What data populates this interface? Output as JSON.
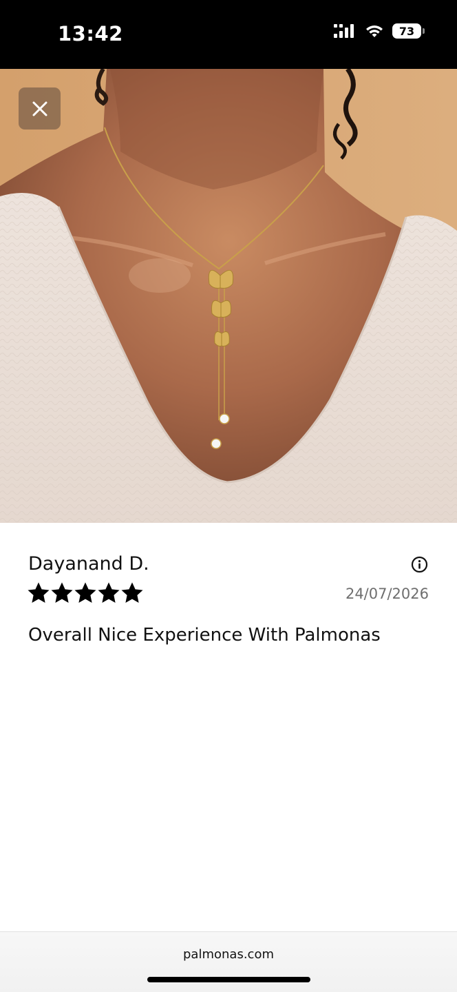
{
  "status_bar": {
    "time": "13:42",
    "battery_level": "73",
    "icons": [
      "signal-icon",
      "wifi-icon",
      "battery-icon"
    ]
  },
  "photo": {
    "close_icon": "close-icon"
  },
  "review": {
    "reviewer_name": "Dayanand D.",
    "rating": 5,
    "rating_max": 5,
    "date": "24/07/2026",
    "text": "Overall Nice Experience With Palmonas",
    "info_icon": "info-icon"
  },
  "browser": {
    "url": "palmonas.com"
  },
  "colors": {
    "status_bar_bg": "#000000",
    "photo_backdrop": "#d7a773",
    "star_color": "#000000",
    "date_color": "#6e6e6e"
  }
}
